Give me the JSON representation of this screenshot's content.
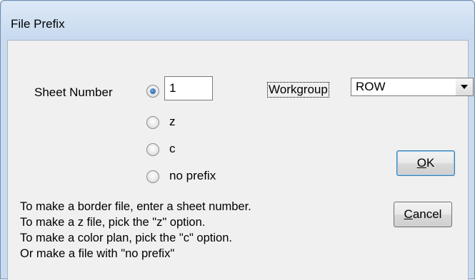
{
  "window": {
    "title": "File Prefix"
  },
  "sheet_number": {
    "label": "Sheet Number",
    "value": "1"
  },
  "options": [
    {
      "label": "z",
      "checked": false
    },
    {
      "label": "c",
      "checked": false
    },
    {
      "label": "no prefix",
      "checked": false
    }
  ],
  "workgroup": {
    "label": "Workgroup",
    "selected": "ROW"
  },
  "buttons": {
    "ok_mnemonic": "O",
    "ok_rest": "K",
    "cancel_mnemonic": "C",
    "cancel_rest": "ancel"
  },
  "instructions": [
    "To make a border file, enter a sheet number.",
    "To make a z file, pick the \"z\" option.",
    "To make a color plan, pick the \"c\" option.",
    "Or make a file with \"no prefix\""
  ]
}
